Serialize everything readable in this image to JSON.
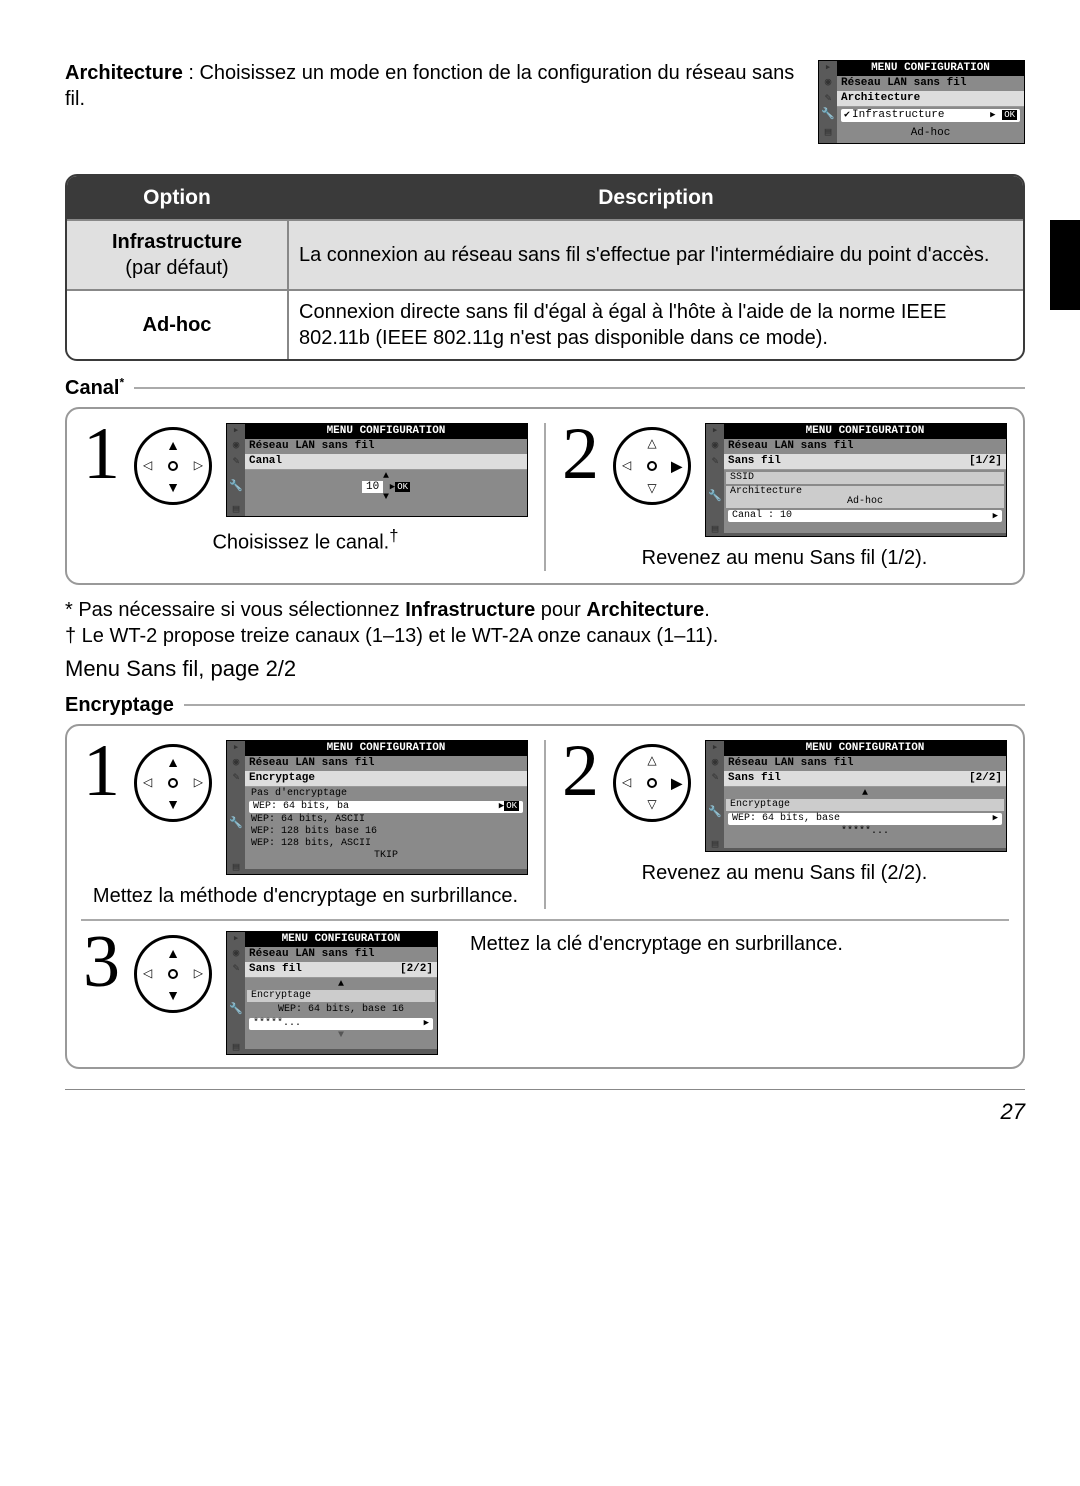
{
  "intro": {
    "label": "Architecture",
    "text": " : Choisissez un mode en fonction de la configuration du réseau sans fil."
  },
  "screen_arch": {
    "title": "MENU CONFIGURATION",
    "sub": "Réseau LAN sans fil",
    "label": "Architecture",
    "opt_sel": "Infrastructure",
    "ok": "OK",
    "opt2": "Ad-hoc"
  },
  "table": {
    "h1": "Option",
    "h2": "Description",
    "r1c1a": "Infrastructure",
    "r1c1b": "(par défaut)",
    "r1c2": "La connexion au réseau sans fil s'effectue par l'intermédiaire du point d'accès.",
    "r2c1": "Ad-hoc",
    "r2c2": "Connexion directe sans fil d'égal à égal à l'hôte à l'aide de la norme IEEE 802.11b (IEEE 802.11g n'est pas disponible dans ce mode)."
  },
  "canal": {
    "head": "Canal",
    "star": "*",
    "step1_cap": "Choisissez le canal.",
    "dagger": "†",
    "step2_cap": "Revenez au menu Sans fil (1/2).",
    "screen1": {
      "title": "MENU CONFIGURATION",
      "sub": "Réseau LAN sans fil",
      "label": "Canal",
      "value": "10",
      "ok": "OK"
    },
    "screen2": {
      "title": "MENU CONFIGURATION",
      "sub": "Réseau LAN sans fil",
      "label": "Sans fil",
      "page": "[1/2]",
      "row1": "SSID",
      "row2a": "Architecture",
      "row2b": "Ad-hoc",
      "row3a": "Canal :",
      "row3b": "10"
    }
  },
  "footnotes": {
    "f1a": "* Pas nécessaire si vous sélectionnez ",
    "f1b": "Infrastructure",
    "f1c": " pour ",
    "f1d": "Architecture",
    "f1e": ".",
    "f2": "† Le WT-2 propose treize canaux (1–13) et le WT-2A onze canaux (1–11)."
  },
  "subhead": "Menu Sans fil, page 2/2",
  "encrypt": {
    "head": "Encryptage",
    "step1_cap": "Mettez la méthode d'encryptage en surbrillance.",
    "step2_cap": "Revenez au menu Sans fil (2/2).",
    "step3_cap": "Mettez la clé d'encryptage en surbrillance.",
    "screen1": {
      "title": "MENU CONFIGURATION",
      "sub": "Réseau LAN sans fil",
      "label": "Encryptage",
      "o1": "Pas d'encryptage",
      "o2": "WEP: 64 bits, ba",
      "ok": "OK",
      "o3": "WEP: 64 bits, ASCII",
      "o4": "WEP: 128 bits base 16",
      "o5": "WEP: 128 bits, ASCII",
      "o6": "TKIP"
    },
    "screen2": {
      "title": "MENU CONFIGURATION",
      "sub": "Réseau LAN sans fil",
      "label": "Sans fil",
      "page": "[2/2]",
      "row1": "Encryptage",
      "row2": "WEP: 64 bits, base",
      "row3": "*****..."
    },
    "screen3": {
      "title": "MENU CONFIGURATION",
      "sub": "Réseau LAN sans fil",
      "label": "Sans fil",
      "page": "[2/2]",
      "row1": "Encryptage",
      "row2": "WEP: 64 bits, base 16",
      "row3": "*****..."
    }
  },
  "pagenum": "27"
}
